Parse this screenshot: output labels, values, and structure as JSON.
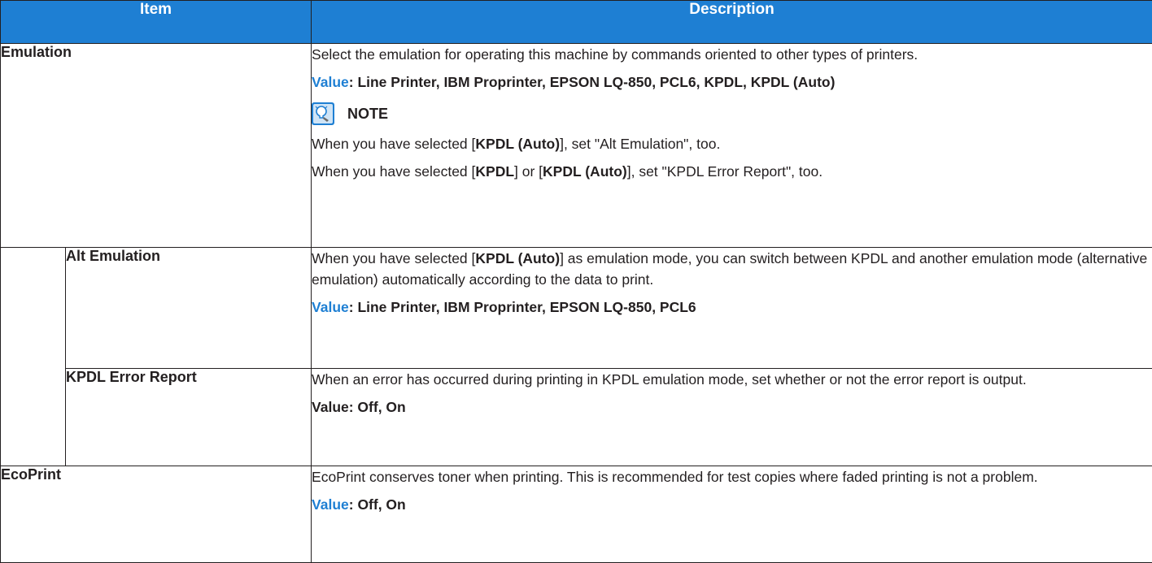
{
  "header": {
    "item": "Item",
    "description": "Description"
  },
  "rows": {
    "emulation": {
      "item": "Emulation",
      "desc": "Select the emulation for operating this machine by commands oriented to other types of printers.",
      "value_label": "Value",
      "value_text": ": Line Printer, IBM Proprinter, EPSON LQ-850, PCL6, KPDL, KPDL (Auto)",
      "note_title": "NOTE",
      "note_line1_a": "When you have selected [",
      "note_line1_b": "KPDL (Auto)",
      "note_line1_c": "], set \"Alt Emulation\", too.",
      "note_line2_a": "When you have selected [",
      "note_line2_b": "KPDL",
      "note_line2_c": "] or [",
      "note_line2_d": "KPDL (Auto)",
      "note_line2_e": "], set \"KPDL Error Report\", too."
    },
    "alt_emulation": {
      "item": "Alt Emulation",
      "desc_a": "When you have selected [",
      "desc_b": "KPDL (Auto)",
      "desc_c": "] as emulation mode, you can switch between KPDL and another emulation mode (alternative emulation) automatically according to the data to print.",
      "value_label": "Value",
      "value_text": ": Line Printer, IBM Proprinter, EPSON LQ-850, PCL6"
    },
    "kpdl_error_report": {
      "item": "KPDL Error Report",
      "desc": "When an error has occurred during printing in KPDL emulation mode, set whether or not the error report is output.",
      "value_text": "Value: Off, On"
    },
    "ecoprint": {
      "item": "EcoPrint",
      "desc": "EcoPrint conserves toner when printing. This is recommended for test copies where faded printing is not a problem.",
      "value_label": "Value",
      "value_text": ": Off, On"
    }
  },
  "icons": {
    "note": "note-lightbulb-icon"
  },
  "colors": {
    "header_bg": "#1e7fd3",
    "value_label": "#1e7fd3",
    "text": "#231f20"
  }
}
